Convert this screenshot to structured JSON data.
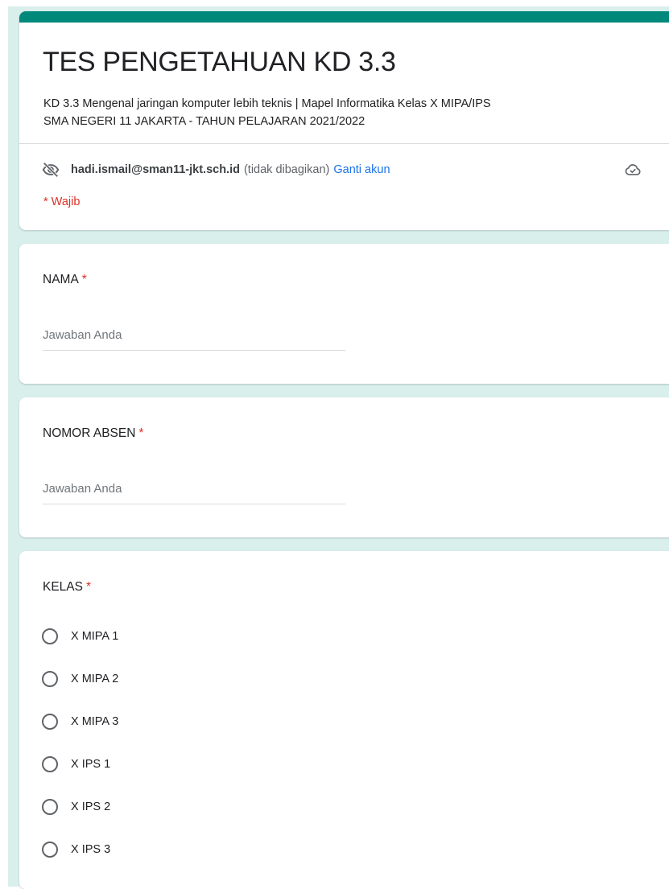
{
  "form": {
    "title": "TES PENGETAHUAN KD 3.3",
    "description_line1": "KD 3.3 Mengenal jaringan komputer lebih teknis | Mapel Informatika Kelas X MIPA/IPS",
    "description_line2": "SMA NEGERI 11 JAKARTA - TAHUN PELAJARAN 2021/2022",
    "accent_color": "#00897b",
    "background_color": "#d9efec"
  },
  "account": {
    "email": "hadi.ismail@sman11-jkt.sch.id",
    "not_shared": "(tidak dibagikan)",
    "switch_label": "Ganti akun",
    "hidden_icon": "eye-off-icon",
    "save_icon": "cloud-check-icon"
  },
  "required_note": "* Wajib",
  "questions": [
    {
      "title": "NAMA",
      "required_mark": "*",
      "placeholder": "Jawaban Anda",
      "value": ""
    },
    {
      "title": "NOMOR ABSEN",
      "required_mark": "*",
      "placeholder": "Jawaban Anda",
      "value": ""
    },
    {
      "title": "KELAS",
      "required_mark": "*",
      "options": [
        "X MIPA 1",
        "X MIPA 2",
        "X MIPA 3",
        "X IPS 1",
        "X IPS 2",
        "X IPS 3"
      ]
    }
  ]
}
